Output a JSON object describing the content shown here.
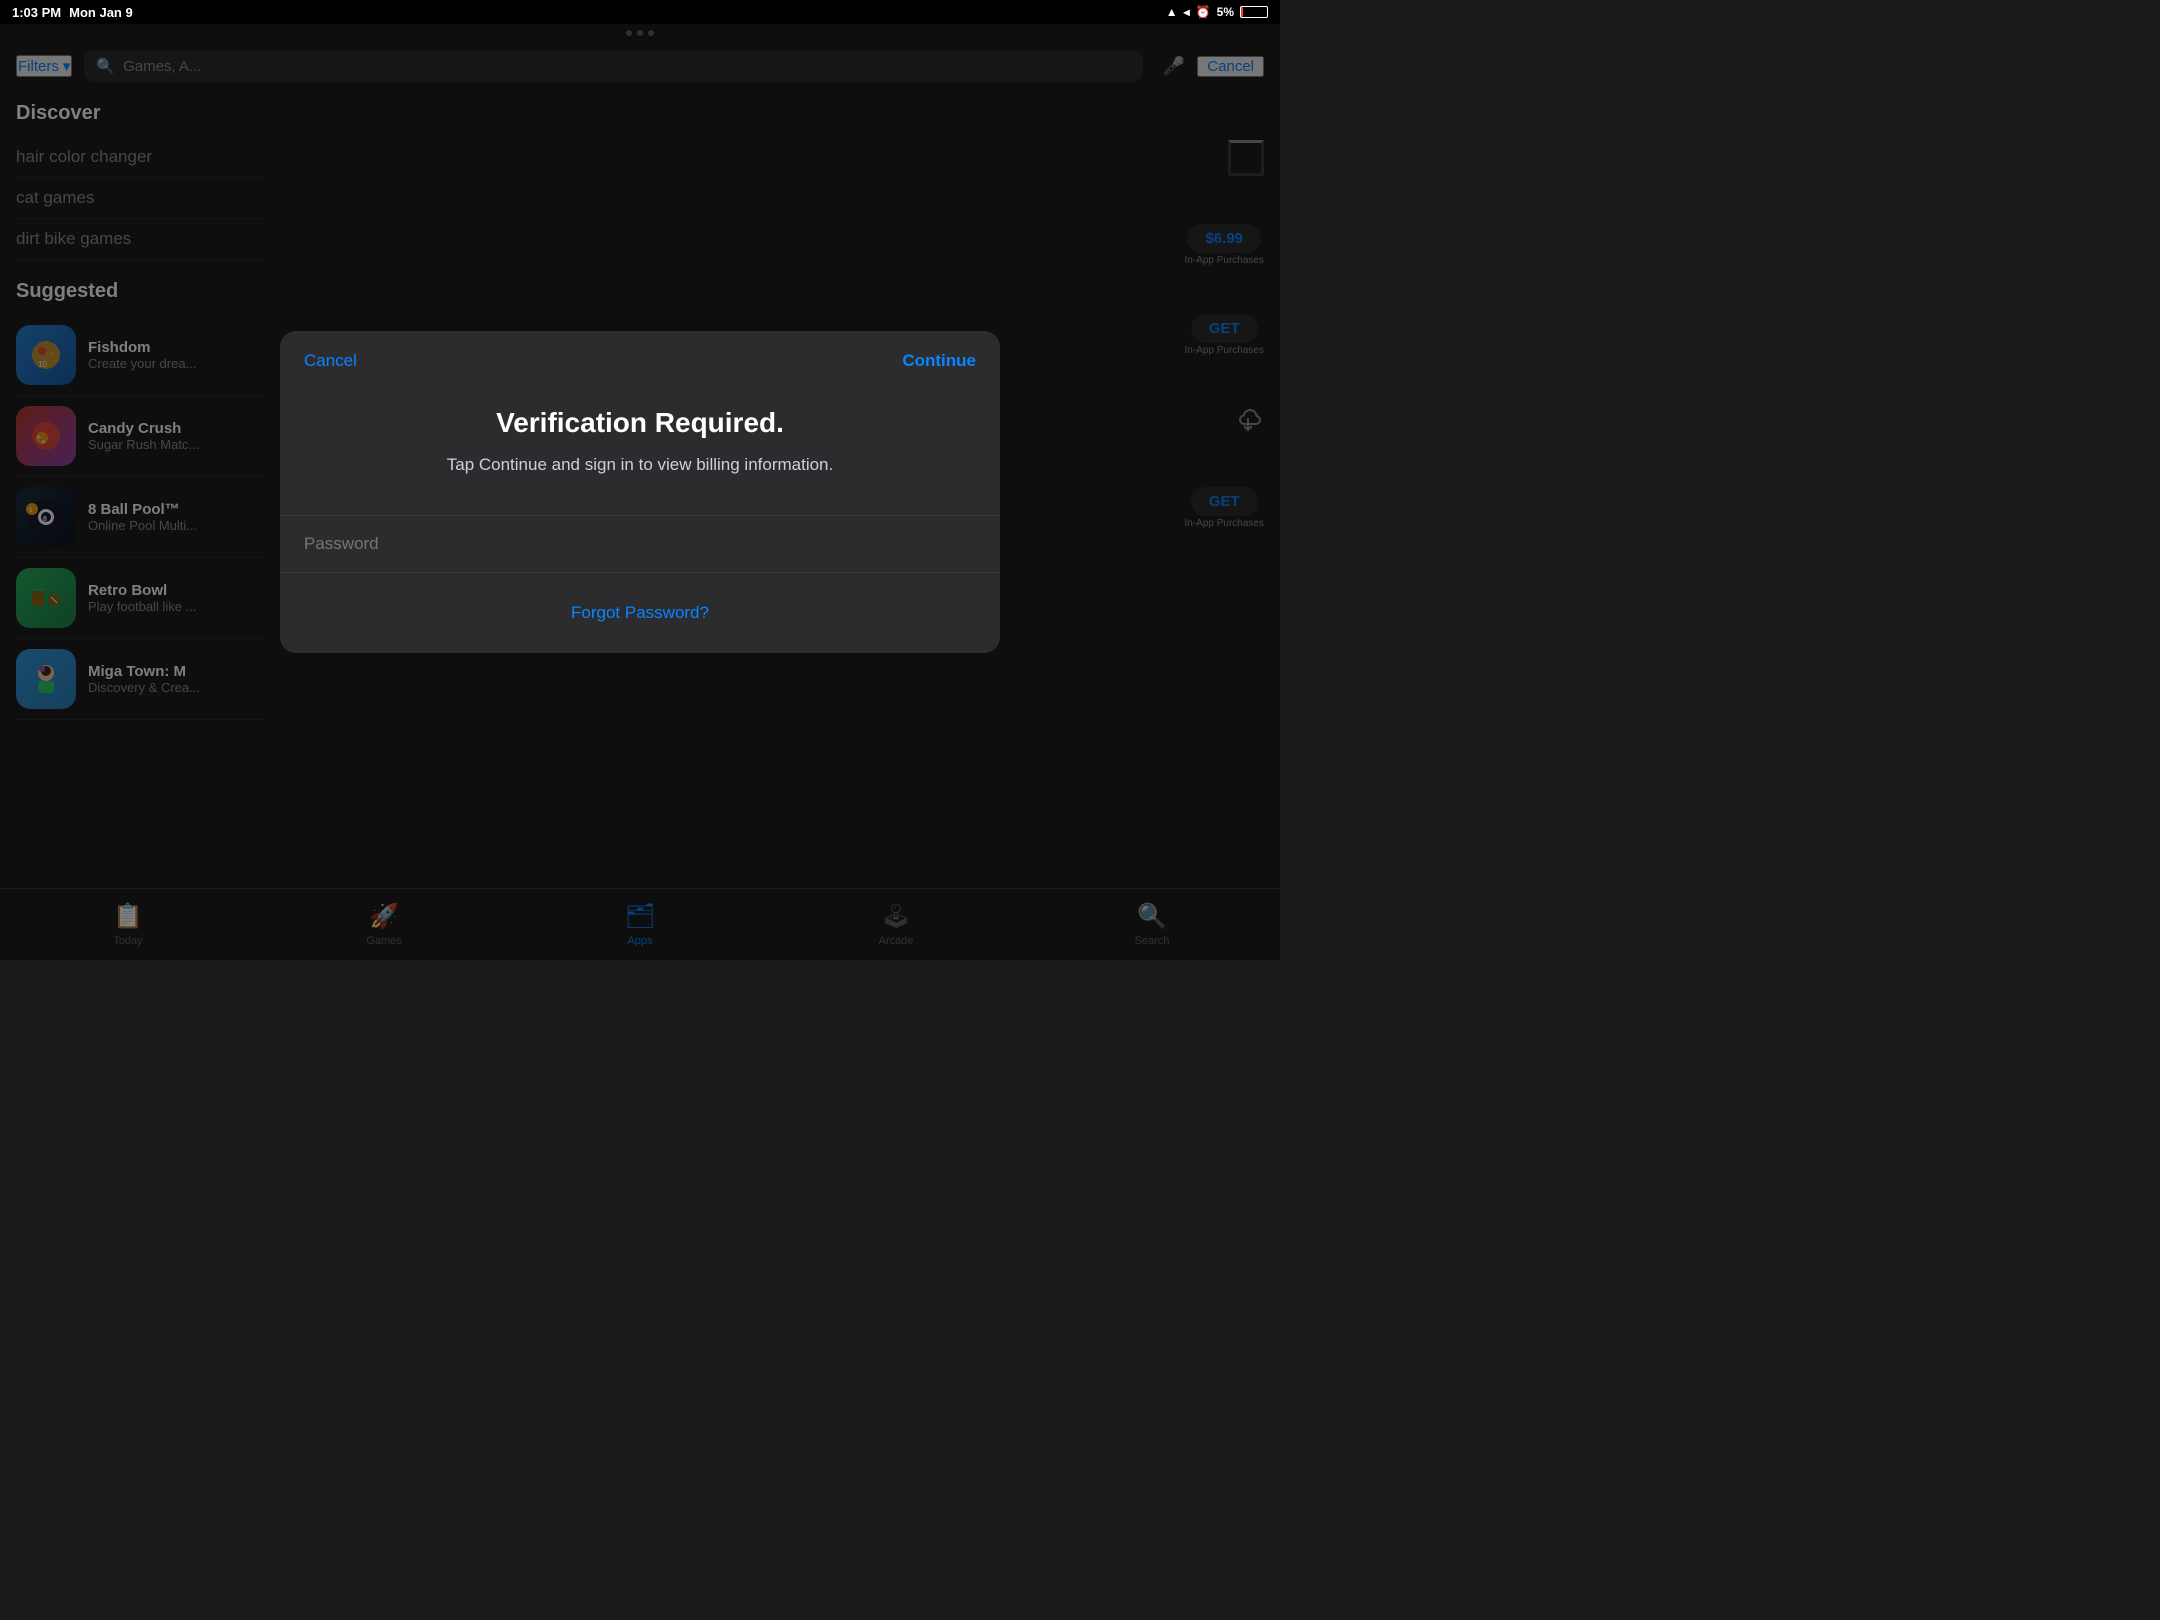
{
  "statusBar": {
    "time": "1:03 PM",
    "date": "Mon Jan 9",
    "battery": "5%",
    "icons": [
      "wifi",
      "location",
      "alarm",
      "battery"
    ]
  },
  "searchBar": {
    "filters_label": "Filters",
    "placeholder": "Games, A...",
    "cancel_label": "Cancel"
  },
  "discover": {
    "title": "Discover",
    "items": [
      {
        "label": "hair color changer"
      },
      {
        "label": "cat games"
      },
      {
        "label": "dirt bike games"
      }
    ]
  },
  "suggested": {
    "title": "Suggested",
    "apps": [
      {
        "name": "Fishdom",
        "desc": "Create your drea..."
      },
      {
        "name": "Candy Crush",
        "desc": "Sugar Rush Matc..."
      },
      {
        "name": "8 Ball Pool™",
        "desc": "Online Pool Multi..."
      },
      {
        "name": "Retro Bowl",
        "desc": "Play football like ..."
      },
      {
        "name": "Miga Town: M",
        "desc": "Discovery & Crea..."
      }
    ]
  },
  "rightActions": [
    {
      "type": "loading"
    },
    {
      "type": "price",
      "label": "$6.99",
      "sub": "In-App Purchases"
    },
    {
      "type": "get",
      "label": "GET",
      "sub": "In-App Purchases"
    },
    {
      "type": "download"
    },
    {
      "type": "get",
      "label": "GET",
      "sub": "In-App Purchases"
    }
  ],
  "tabBar": {
    "items": [
      {
        "label": "Today",
        "icon": "📋",
        "active": false
      },
      {
        "label": "Games",
        "icon": "🚀",
        "active": false
      },
      {
        "label": "Apps",
        "icon": "🗂",
        "active": true
      },
      {
        "label": "Arcade",
        "icon": "🕹",
        "active": false
      },
      {
        "label": "Search",
        "icon": "🔍",
        "active": false
      }
    ]
  },
  "modal": {
    "cancel_label": "Cancel",
    "continue_label": "Continue",
    "title": "Verification Required.",
    "subtitle": "Tap Continue and sign in to view billing information.",
    "password_placeholder": "Password",
    "forgot_password_label": "Forgot Password?"
  },
  "threeDots": {
    "count": 3
  }
}
